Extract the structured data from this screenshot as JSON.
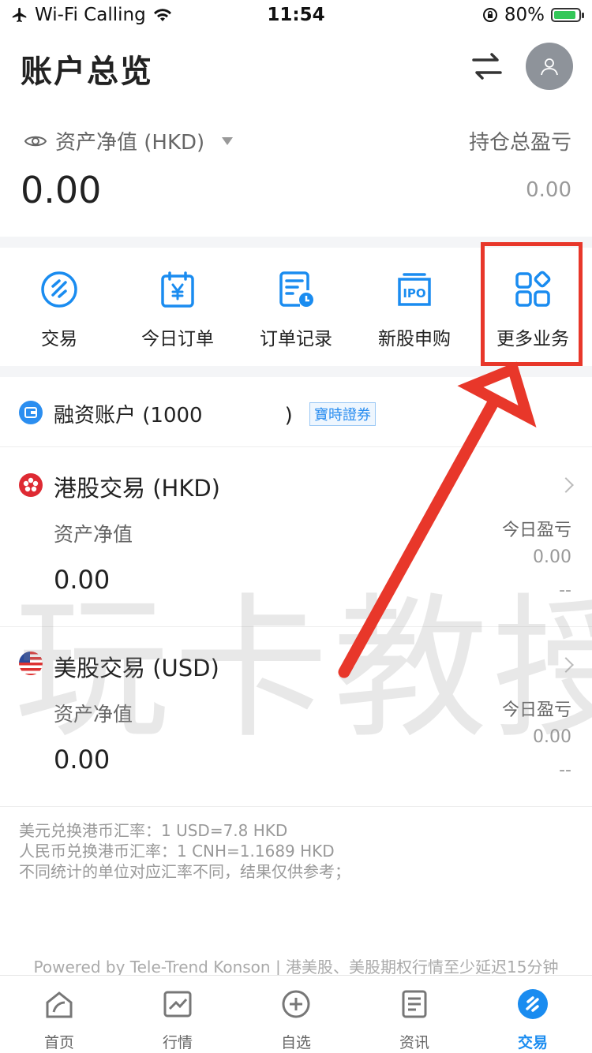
{
  "status_bar": {
    "carrier": "Wi-Fi Calling",
    "time": "11:54",
    "battery": "80%"
  },
  "header": {
    "title": "账户总览"
  },
  "summary": {
    "asset_label": "资产净值 (HKD)",
    "asset_value": "0.00",
    "pl_label": "持仓总盈亏",
    "pl_value": "0.00"
  },
  "actions": [
    {
      "label": "交易",
      "icon": "trade-icon"
    },
    {
      "label": "今日订单",
      "icon": "calendar-yen-icon"
    },
    {
      "label": "订单记录",
      "icon": "order-history-icon"
    },
    {
      "label": "新股申购",
      "icon": "ipo-icon"
    },
    {
      "label": "更多业务",
      "icon": "grid-more-icon"
    }
  ],
  "margin_account": {
    "label": "融资账户 (1000",
    "suffix": ")",
    "badge": "寶時證券"
  },
  "markets": [
    {
      "title": "港股交易 (HKD)",
      "asset_label": "资产净值",
      "asset_value": "0.00",
      "pl_label": "今日盈亏",
      "pl_value": "0.00",
      "pl_pct": "--"
    },
    {
      "title": "美股交易 (USD)",
      "asset_label": "资产净值",
      "asset_value": "0.00",
      "pl_label": "今日盈亏",
      "pl_value": "0.00",
      "pl_pct": "--"
    }
  ],
  "watermark": "玩卡教授",
  "notes": [
    "美元兑换港币汇率：1 USD=7.8 HKD",
    "人民币兑换港币汇率：1 CNH=1.1689 HKD",
    "不同统计的单位对应汇率不同，结果仅供参考；"
  ],
  "powered_by": "Powered by Tele-Trend Konson | 港美股、美股期权行情至少延迟15分钟",
  "tabs": [
    {
      "label": "首页",
      "icon": "home-icon"
    },
    {
      "label": "行情",
      "icon": "chart-icon"
    },
    {
      "label": "自选",
      "icon": "plus-circle-icon"
    },
    {
      "label": "资讯",
      "icon": "news-icon"
    },
    {
      "label": "交易",
      "icon": "trade-tab-icon",
      "active": true
    }
  ],
  "colors": {
    "accent": "#1a8cf0",
    "highlight": "#e8372a"
  }
}
